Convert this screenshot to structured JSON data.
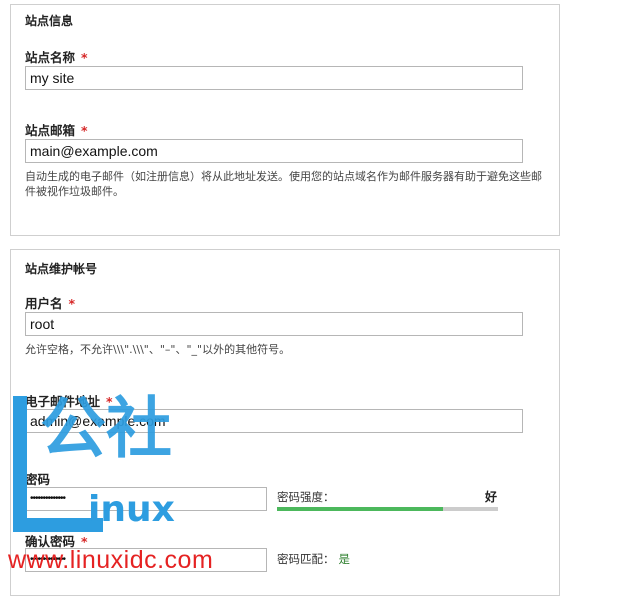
{
  "site_info": {
    "legend": "站点信息",
    "site_name_label": "站点名称",
    "site_name_value": "my site",
    "site_email_label": "站点邮箱",
    "site_email_value": "main@example.com",
    "site_email_desc": "自动生成的电子邮件（如注册信息）将从此地址发送。使用您的站点域名作为邮件服务器有助于避免这些邮件被视作垃圾邮件。"
  },
  "account": {
    "legend": "站点维护帐号",
    "username_label": "用户名",
    "username_value": "root",
    "username_desc": "允许空格，不允许\\\\\\\".\\\\\\\"、\"–\"、\"_\"以外的其他符号。",
    "email_label": "电子邮件地址",
    "email_value": "admin@example.com",
    "password_label": "密码",
    "password_value": "••••••••••••••",
    "strength_label": "密码强度：",
    "strength_value": "好",
    "strength_fraction": 0.75,
    "confirm_label": "确认密码",
    "confirm_value": "••••••••••••••",
    "match_label": "密码匹配：",
    "match_value": "是"
  },
  "required_marker": "*",
  "watermark": {
    "chars_top": "公社",
    "linux_text": "inux",
    "url": "www.linuxidc.com"
  },
  "colors": {
    "required": "#d62828",
    "strength_good": "#4cb85c",
    "watermark_blue": "#2d9de0",
    "watermark_red": "#e52222"
  }
}
